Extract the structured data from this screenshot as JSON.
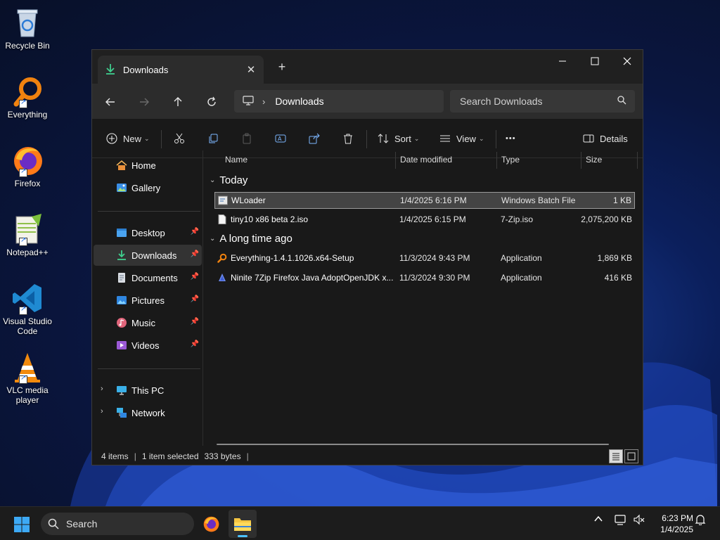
{
  "desktop": {
    "icons": [
      {
        "label": "Recycle Bin",
        "icon": "recycle-bin-icon"
      },
      {
        "label": "Everything",
        "icon": "everything-search-icon"
      },
      {
        "label": "Firefox",
        "icon": "firefox-icon"
      },
      {
        "label": "Notepad++",
        "icon": "notepadpp-icon"
      },
      {
        "label": "Visual Studio Code",
        "icon": "vscode-icon"
      },
      {
        "label": "VLC media player",
        "icon": "vlc-icon"
      }
    ]
  },
  "window": {
    "tab_title": "Downloads",
    "new_tab": "+",
    "breadcrumb": [
      "Downloads"
    ],
    "search_placeholder": "Search Downloads",
    "toolbar": {
      "new_label": "New",
      "sort_label": "Sort",
      "view_label": "View",
      "more_label": "•••",
      "details_label": "Details"
    },
    "nav": {
      "items": [
        {
          "label": "Home",
          "icon": "home-icon"
        },
        {
          "label": "Gallery",
          "icon": "gallery-icon"
        },
        {
          "label": "Desktop",
          "icon": "desktop-folder-icon",
          "pinned": true
        },
        {
          "label": "Downloads",
          "icon": "downloads-folder-icon",
          "pinned": true,
          "selected": true
        },
        {
          "label": "Documents",
          "icon": "documents-folder-icon",
          "pinned": true
        },
        {
          "label": "Pictures",
          "icon": "pictures-folder-icon",
          "pinned": true
        },
        {
          "label": "Music",
          "icon": "music-folder-icon",
          "pinned": true
        },
        {
          "label": "Videos",
          "icon": "videos-folder-icon",
          "pinned": true
        },
        {
          "label": "This PC",
          "icon": "this-pc-icon"
        },
        {
          "label": "Network",
          "icon": "network-icon"
        }
      ]
    },
    "columns": [
      "Name",
      "Date modified",
      "Type",
      "Size"
    ],
    "groups": [
      {
        "label": "Today",
        "files": [
          {
            "name": "WLoader",
            "date": "1/4/2025 6:16 PM",
            "type": "Windows Batch File",
            "size": "1 KB",
            "selected": true,
            "icon": "batch-file-icon"
          },
          {
            "name": "tiny10 x86 beta 2.iso",
            "date": "1/4/2025 6:15 PM",
            "type": "7-Zip.iso",
            "size": "2,075,200 KB",
            "icon": "iso-file-icon"
          }
        ]
      },
      {
        "label": "A long time ago",
        "files": [
          {
            "name": "Everything-1.4.1.1026.x64-Setup",
            "date": "11/3/2024 9:43 PM",
            "type": "Application",
            "size": "1,869 KB",
            "icon": "everything-setup-icon"
          },
          {
            "name": "Ninite 7Zip Firefox Java AdoptOpenJDK x...",
            "date": "11/3/2024 9:30 PM",
            "type": "Application",
            "size": "416 KB",
            "icon": "ninite-icon"
          }
        ]
      }
    ],
    "status": {
      "items": "4 items",
      "selected": "1 item selected",
      "bytes": "333 bytes",
      "divider": "|"
    }
  },
  "taskbar": {
    "search_label": "Search",
    "time": "6:23 PM",
    "date": "1/4/2025"
  }
}
